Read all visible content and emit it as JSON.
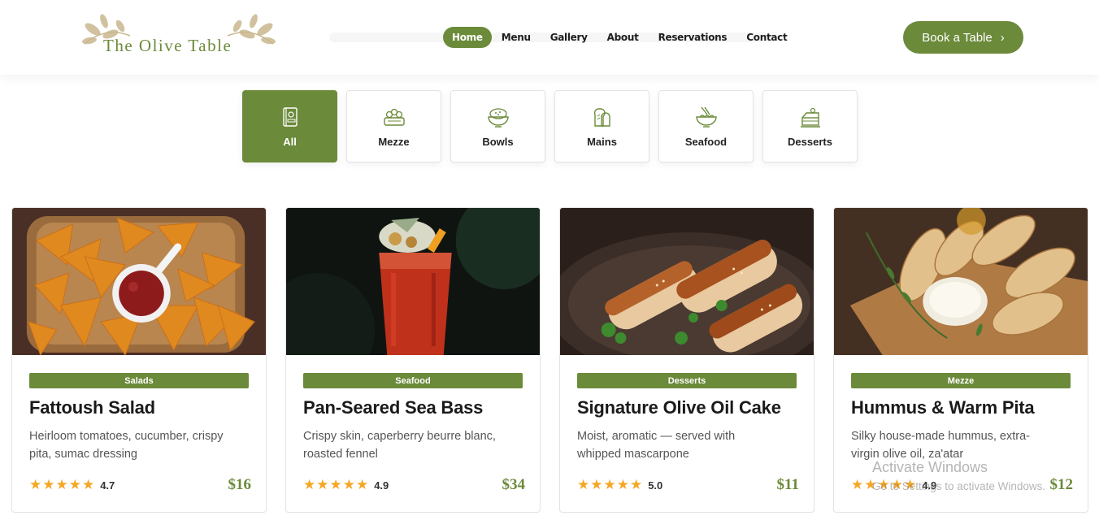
{
  "brand": {
    "logo_text": "The Olive Table"
  },
  "nav": {
    "items": [
      "Home",
      "Menu",
      "Gallery",
      "About",
      "Reservations",
      "Contact"
    ],
    "active": "Home"
  },
  "cta": {
    "label": "Book a Table",
    "icon": "chevron-right-icon"
  },
  "categories": [
    {
      "label": "All",
      "icon": "menu-book-icon",
      "active": true
    },
    {
      "label": "Mezze",
      "icon": "mezze-platter-icon",
      "active": false
    },
    {
      "label": "Bowls",
      "icon": "bowl-icon",
      "active": false
    },
    {
      "label": "Mains",
      "icon": "bread-icon",
      "active": false
    },
    {
      "label": "Seafood",
      "icon": "noodle-bowl-icon",
      "active": false
    },
    {
      "label": "Desserts",
      "icon": "cake-icon",
      "active": false
    }
  ],
  "cards": [
    {
      "tag": "Salads",
      "title": "Fattoush Salad",
      "description": "Heirloom tomatoes, cucumber, crispy pita, sumac dressing",
      "rating": "4.7",
      "stars": 5,
      "price": "$16"
    },
    {
      "tag": "Seafood",
      "title": "Pan-Seared Sea Bass",
      "description": "Crispy skin, caperberry beurre blanc, roasted fennel",
      "rating": "4.9",
      "stars": 5,
      "price": "$34"
    },
    {
      "tag": "Desserts",
      "title": "Signature Olive Oil Cake",
      "description": "Moist, aromatic — served with whipped mascarpone",
      "rating": "5.0",
      "stars": 5,
      "price": "$11"
    },
    {
      "tag": "Mezze",
      "title": "Hummus & Warm Pita",
      "description": "Silky house-made hummus, extra-virgin olive oil, za'atar",
      "rating": "4.9",
      "stars": 5,
      "price": "$12"
    }
  ],
  "watermark": {
    "title": "Activate Windows",
    "subtitle": "Go to Settings to activate Windows."
  },
  "colors": {
    "accent": "#6b8a3a",
    "star": "#f5a623"
  }
}
